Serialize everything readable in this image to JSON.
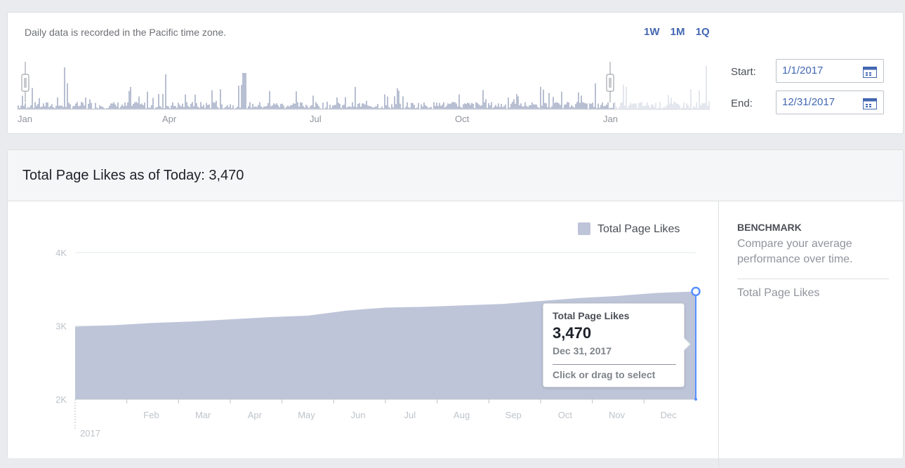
{
  "range_selector": {
    "timezone_note": "Daily data is recorded in the Pacific time zone.",
    "presets": [
      "1W",
      "1M",
      "1Q"
    ],
    "timeline_labels": [
      "Jan",
      "Apr",
      "Jul",
      "Oct",
      "Jan"
    ],
    "start_label": "Start:",
    "start_value": "1/1/2017",
    "end_label": "End:",
    "end_value": "12/31/2017"
  },
  "main": {
    "title": "Total Page Likes as of Today: 3,470"
  },
  "benchmark": {
    "title": "BENCHMARK",
    "description": "Compare your average performance over time.",
    "metric_link": "Total Page Likes"
  },
  "tooltip": {
    "series": "Total Page Likes",
    "value": "3,470",
    "date": "Dec 31, 2017",
    "hint": "Click or drag to select"
  },
  "colors": {
    "area_fill": "#bec5d9",
    "accent_blue": "#4267b2",
    "handle_blue": "#5890ff"
  },
  "chart_data": {
    "type": "area",
    "series": [
      {
        "name": "Total Page Likes",
        "x": [
          "Jan 1",
          "Jan 15",
          "Feb 1",
          "Mar 1",
          "Apr 1",
          "May 1",
          "May 15",
          "Jun 1",
          "Jul 1",
          "Aug 1",
          "Sep 1",
          "Sep 15",
          "Oct 1",
          "Nov 1",
          "Nov 15",
          "Dec 1",
          "Dec 31"
        ],
        "values": [
          2990,
          3010,
          3040,
          3060,
          3090,
          3120,
          3140,
          3210,
          3250,
          3260,
          3280,
          3300,
          3340,
          3380,
          3410,
          3450,
          3470
        ]
      }
    ],
    "y_ticks": [
      "4K",
      "3K",
      "2K"
    ],
    "ylim": [
      2000,
      4000
    ],
    "x_ticks": [
      "Feb",
      "Mar",
      "Apr",
      "May",
      "Jun",
      "Jul",
      "Aug",
      "Sep",
      "Oct",
      "Nov",
      "Dec"
    ],
    "x_year_label": "2017",
    "legend": "Total Page Likes",
    "legend_position": "top-right",
    "grid": true
  }
}
